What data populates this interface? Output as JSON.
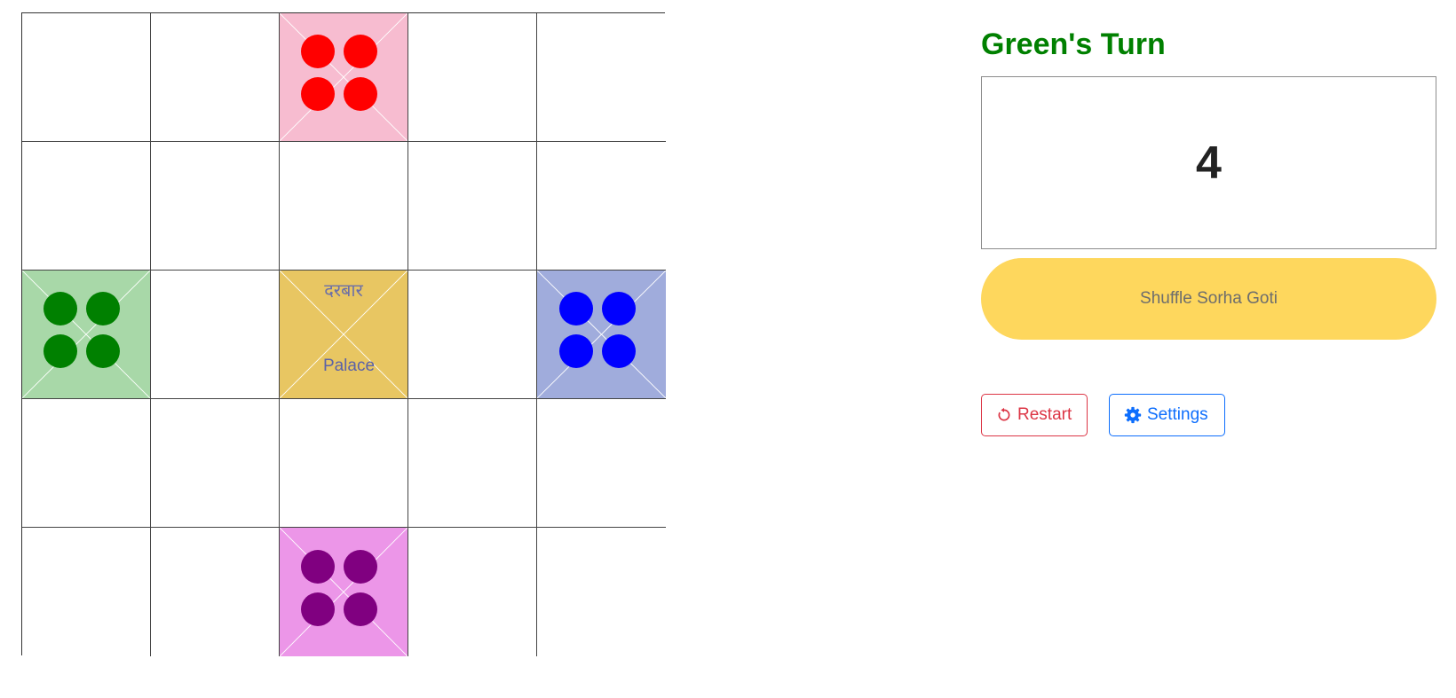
{
  "board": {
    "rows": 5,
    "cols": 5,
    "palace": {
      "line1": "दरबार",
      "line2": "Palace",
      "color": "#e8c662"
    },
    "homes": [
      {
        "player": "red",
        "row": 0,
        "col": 2,
        "bg": "#f7bcd0",
        "pawn_color": "#ff0000",
        "pawns": 4
      },
      {
        "player": "green",
        "row": 2,
        "col": 0,
        "bg": "#a8d8a8",
        "pawn_color": "#008000",
        "pawns": 4
      },
      {
        "player": "blue",
        "row": 2,
        "col": 4,
        "bg": "#a0acdc",
        "pawn_color": "#0000ff",
        "pawns": 4
      },
      {
        "player": "purple",
        "row": 4,
        "col": 2,
        "bg": "#ec96e8",
        "pawn_color": "#800080",
        "pawns": 4
      }
    ]
  },
  "status": {
    "turn_text": "Green's Turn",
    "turn_color": "#008000"
  },
  "dice": {
    "value": "4"
  },
  "controls": {
    "shuffle_label": "Shuffle Sorha Goti",
    "shuffle_color": "#fed75d",
    "restart_label": "Restart",
    "restart_icon": "restart-icon",
    "settings_label": "Settings",
    "settings_icon": "gear-icon"
  }
}
